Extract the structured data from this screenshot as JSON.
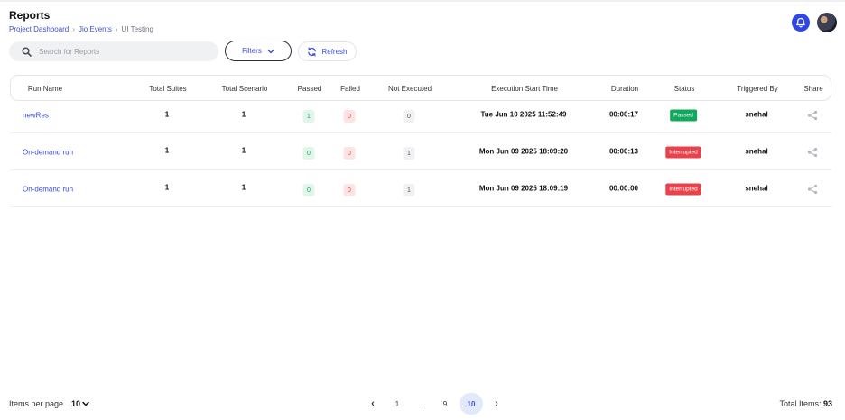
{
  "header": {
    "title": "Reports",
    "breadcrumb": [
      {
        "label": "Project Dashboard"
      },
      {
        "label": "Jio Events"
      },
      {
        "label": "UI Testing"
      }
    ]
  },
  "toolbar": {
    "search_placeholder": "Search for Reports",
    "filters_label": "Filters",
    "refresh_label": "Refresh"
  },
  "table": {
    "columns": [
      "Run Name",
      "Total Suites",
      "Total Scenario",
      "Passed",
      "Failed",
      "Not Executed",
      "Execution Start Time",
      "Duration",
      "Status",
      "Triggered By",
      "Share"
    ],
    "rows": [
      {
        "run_name": "newRes",
        "total_suites": "1",
        "total_scenario": "1",
        "passed": "1",
        "failed": "0",
        "not_executed": "0",
        "start_time": "Tue Jun 10 2025 11:52:49",
        "duration": "00:00:17",
        "status": "Passed",
        "triggered_by": "snehal"
      },
      {
        "run_name": "On-demand run",
        "total_suites": "1",
        "total_scenario": "1",
        "passed": "0",
        "failed": "0",
        "not_executed": "1",
        "start_time": "Mon Jun 09 2025 18:09:20",
        "duration": "00:00:13",
        "status": "Interrupted",
        "triggered_by": "snehal"
      },
      {
        "run_name": "On-demand run",
        "total_suites": "1",
        "total_scenario": "1",
        "passed": "0",
        "failed": "0",
        "not_executed": "1",
        "start_time": "Mon Jun 09 2025 18:09:19",
        "duration": "00:00:00",
        "status": "Interrupted",
        "triggered_by": "snehal"
      }
    ]
  },
  "footer": {
    "items_per_page_label": "Items per page",
    "items_per_page_value": "10",
    "pages": {
      "prev": "‹",
      "first": "1",
      "ellipsis": "...",
      "nine": "9",
      "current": "10",
      "next": "›"
    },
    "total_items_label": "Total Items:",
    "total_items_value": "93"
  },
  "colors": {
    "accent": "#3b4fd8",
    "passed": "#12a85c",
    "interrupted": "#e9424b",
    "notification": "#2f46e6"
  }
}
